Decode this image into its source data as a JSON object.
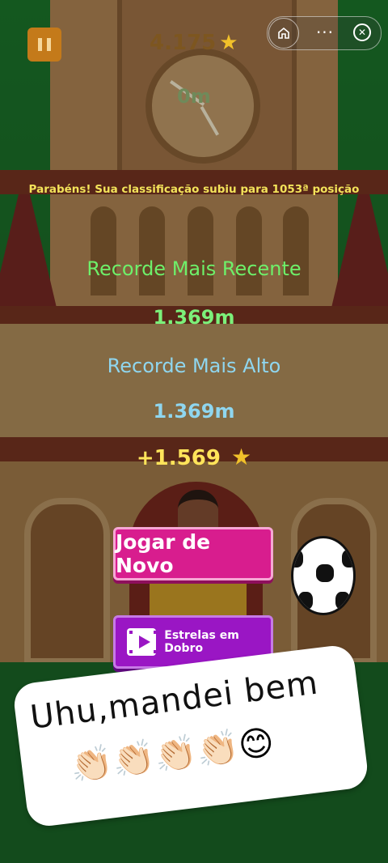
{
  "hud": {
    "coins": "4.175",
    "distance": "0m"
  },
  "rank_message": "Parabéns! Sua classificação subiu para 1053ª posição",
  "recent_record": {
    "label": "Recorde Mais Recente",
    "value": "1.369m"
  },
  "highest_record": {
    "label": "Recorde Mais Alto",
    "value": "1.369m"
  },
  "bonus": "+1.569",
  "buttons": {
    "play_again": "Jogar de Novo",
    "double_stars": "Estrelas em Dobro"
  },
  "capsule": {
    "more": "···"
  },
  "sticker": {
    "text": "Uhu,mandei bem",
    "emojis": "👏🏻👏🏻👏🏻👏🏻😊"
  },
  "colors": {
    "play_button": "#d81d8e",
    "double_button": "#9a16c4",
    "recent_label": "#6ef06a",
    "high_label": "#8fd6ef",
    "rank_message": "#f3e35a"
  }
}
